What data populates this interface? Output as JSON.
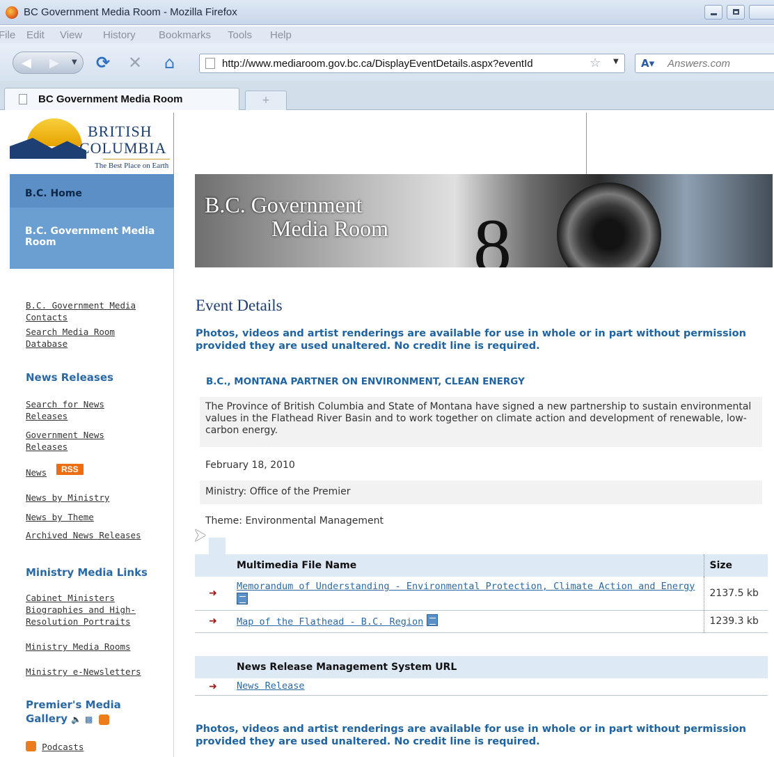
{
  "browser": {
    "window_title": "BC Government Media Room - Mozilla Firefox",
    "menu": [
      "File",
      "Edit",
      "View",
      "History",
      "Bookmarks",
      "Tools",
      "Help"
    ],
    "url": "http://www.mediaroom.gov.bc.ca/DisplayEventDetails.aspx?eventId",
    "search_placeholder": "Answers.com",
    "tab_label": "BC Government Media Room",
    "new_tab_symbol": "+"
  },
  "logo": {
    "line1": "BRITISH",
    "line2": "COLUMBIA",
    "tagline": "The Best Place on Earth"
  },
  "banner": {
    "line1": "B.C. Government",
    "line2": "Media Room"
  },
  "sidebar": {
    "home": "B.C. Home",
    "media_room": "B.C. Government Media Room",
    "contacts": "B.C. Government Media Contacts",
    "search_db": "Search Media Room Database",
    "news_releases_head": "News Releases",
    "search_news": "Search for News Releases",
    "gov_news": "Government News Releases",
    "news": "News",
    "rss": "RSS",
    "news_by_ministry": "News by Ministry",
    "news_by_theme": "News by Theme",
    "archived": "Archived News Releases",
    "ministry_media_head": "Ministry Media Links",
    "cabinet": "Cabinet Ministers Biographies and High-Resolution Portraits",
    "ministry_rooms": "Ministry Media Rooms",
    "enewsletters": "Ministry e-Newsletters",
    "premier_gallery": "Premier's Media Gallery",
    "podcasts": "Podcasts"
  },
  "main": {
    "title": "Event Details",
    "notice": "Photos, videos and artist renderings are available for use in whole or in part without permission provided they are used unaltered. No credit line is required.",
    "event_heading": "B.C., MONTANA PARTNER ON ENVIRONMENT, CLEAN ENERGY",
    "description": "The Province of British Columbia and State of Montana have signed a new partnership to sustain environmental values in the Flathead River Basin and to work together on climate action and development of renewable, low-carbon energy.",
    "date": "February 18, 2010",
    "ministry": "Ministry: Office of the Premier",
    "theme": "Theme: Environmental Management"
  },
  "files_table": {
    "col_name": "Multimedia File Name",
    "col_size": "Size",
    "rows": [
      {
        "name": "Memorandum of Understanding - Environmental Protection, Climate Action and Energy",
        "size": "2137.5 kb"
      },
      {
        "name": "Map of the Flathead - B.C. Region",
        "size": "1239.3 kb"
      }
    ]
  },
  "nrms_table": {
    "col_name": "News Release Management System URL",
    "rows": [
      {
        "name": "News Release"
      }
    ]
  },
  "colors": {
    "link_blue": "#2a69a6",
    "heading_blue": "#1f63a0",
    "sidebar_blue": "#6b9fd2",
    "rss_orange": "#ec6d12",
    "arrow_red": "#a01818"
  }
}
